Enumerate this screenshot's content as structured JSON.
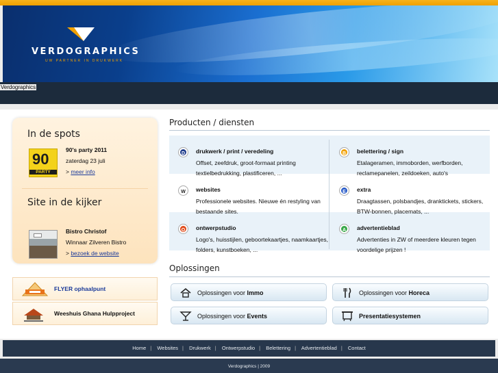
{
  "header": {
    "logo_text": "VERDOGRAPHICS",
    "logo_tagline": "UW PARTNER IN DRUKWERK",
    "site_name": "Verdographics",
    "accent": "#f0a000"
  },
  "spots": {
    "heading": "In de spots",
    "image_label_big": "90",
    "image_label_small": "PARTY",
    "title": "90's party 2011",
    "date": "zaterdag 23 juli",
    "link_prefix": "> ",
    "link": "meer info"
  },
  "kijker": {
    "heading": "Site in de kijker",
    "title": "Bistro Christof",
    "subtitle": "Winnaar Zilveren Bistro",
    "link_prefix": "> ",
    "link": "bezoek de website"
  },
  "side_banners": [
    {
      "label": "FLYER ophaalpunt",
      "color": "#1a3a9a"
    },
    {
      "label": "Weeshuis Ghana Hulpproject",
      "color": "#111111"
    }
  ],
  "products": {
    "heading": "Producten / diensten",
    "items": [
      {
        "letter": "D",
        "color": "#1e3c8c",
        "title": "drukwerk / print / veredeling",
        "desc": "Offset, zeefdruk, groot-formaat printing textielbedrukking, plastificeren, ..."
      },
      {
        "letter": "B",
        "color": "#f0a000",
        "title": "belettering / sign",
        "desc": "Etalageramen, immoborden, werfborden, reclamepanelen, zeildoeken, auto's"
      },
      {
        "letter": "W",
        "color": "#ffffff",
        "title": "websites",
        "desc": "Professionele websites. Nieuwe én restyling van bestaande sites."
      },
      {
        "letter": "E",
        "color": "#2a5cc8",
        "title": "extra",
        "desc": "Draagtassen, polsbandjes, dranktickets, stickers, BTW-bonnen, placemats, ..."
      },
      {
        "letter": "O",
        "color": "#e04a1a",
        "title": "ontwerpstudio",
        "desc": "Logo's, huisstijlen, geboortekaartjes, naamkaartjes, folders, kunstboeken, ..."
      },
      {
        "letter": "A",
        "color": "#3aa84a",
        "title": "advertentieblad",
        "desc": "Advertenties in ZW of meerdere kleuren tegen voordelige prijzen !"
      }
    ]
  },
  "solutions": {
    "heading": "Oplossingen",
    "buttons": [
      {
        "prefix": "Oplossingen voor ",
        "bold": "Immo",
        "icon": "house-icon"
      },
      {
        "prefix": "Oplossingen voor ",
        "bold": "Horeca",
        "icon": "cutlery-icon"
      },
      {
        "prefix": "Oplossingen voor ",
        "bold": "Events",
        "icon": "cocktail-icon"
      },
      {
        "prefix": "",
        "bold": "Presentatiesystemen",
        "icon": "display-stand-icon"
      }
    ]
  },
  "footer": {
    "links": [
      "Home",
      "Websites",
      "Drukwerk",
      "Ontwerpstudio",
      "Belettering",
      "Advertentieblad",
      "Contact"
    ],
    "separator": "|",
    "copyright": "Verdographics | 2009"
  }
}
